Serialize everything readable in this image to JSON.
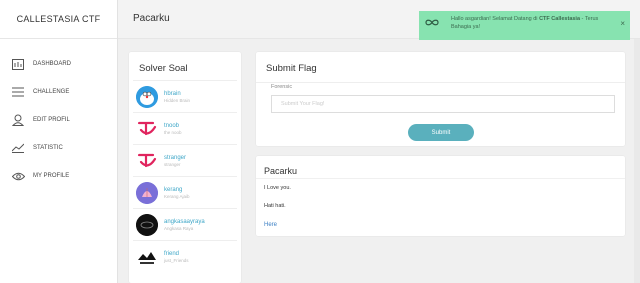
{
  "sidebar": {
    "brand": "CALLESTASIA CTF",
    "items": [
      {
        "label": "DASHBOARD",
        "icon": "dashboard-icon"
      },
      {
        "label": "CHALLENGE",
        "icon": "menu-icon"
      },
      {
        "label": "EDIT PROFIL",
        "icon": "user-icon"
      },
      {
        "label": "STATISTIC",
        "icon": "chart-line-icon"
      },
      {
        "label": "MY PROFILE",
        "icon": "eye-icon"
      }
    ]
  },
  "header": {
    "title": "Pacarku"
  },
  "toast": {
    "text_pre": "Hallo asgardian! Selamat Datang di ",
    "text_brand": "CTF Callestasia",
    "text_post": " - Terus Bahagia ya!",
    "close": "×",
    "color": "#87e3b0"
  },
  "solvers": {
    "title": "Solver Soal",
    "items": [
      {
        "name": "hbrain",
        "sub": "Hidden Brain",
        "avatar": "doraemon"
      },
      {
        "name": "tnoob",
        "sub": "the noob",
        "avatar": "twice-logo"
      },
      {
        "name": "stranger",
        "sub": "stranger",
        "avatar": "twice-logo"
      },
      {
        "name": "kerang",
        "sub": "Kerang Ajaib",
        "avatar": "shell"
      },
      {
        "name": "angkasaayraya",
        "sub": "Angkasa Raya",
        "avatar": "dark-logo"
      },
      {
        "name": "friend",
        "sub": "just_Friends",
        "avatar": "wavepoint"
      }
    ]
  },
  "submit": {
    "title": "Submit Flag",
    "category": "Forensic",
    "placeholder": "Submit Your Flag!",
    "button": "Submit"
  },
  "challenge": {
    "title": "Pacarku",
    "lines": [
      "I Love you.",
      "Hati hati."
    ],
    "link": "Here"
  },
  "colors": {
    "accent": "#5ab0bd",
    "link": "#3fa7c8",
    "twice": "#e0245e"
  }
}
